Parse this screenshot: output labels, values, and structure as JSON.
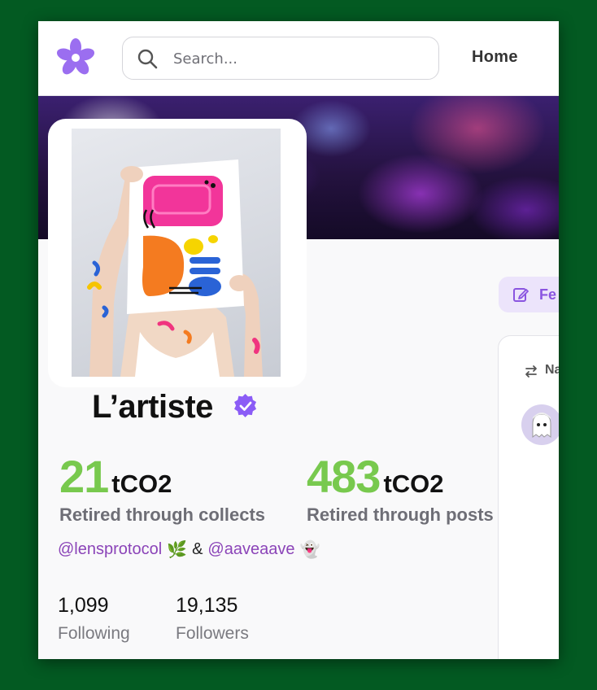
{
  "header": {
    "logo": "lens-flower-logo",
    "search": {
      "placeholder": "Search...",
      "value": ""
    },
    "nav": {
      "home_label": "Home"
    }
  },
  "profile": {
    "display_name": "L’artiste",
    "verified": true,
    "stats": [
      {
        "value": "21",
        "unit": "tCO2",
        "caption": "Retired through collects"
      },
      {
        "value": "483",
        "unit": "tCO2",
        "caption": "Retired through posts"
      }
    ],
    "bio": {
      "handle_1": "@lensprotocol",
      "handle_1_emoji": "🌿",
      "separator": "&",
      "handle_2": "@aaveaave",
      "handle_2_emoji": "👻"
    },
    "following": {
      "count": "1,099",
      "label": "Following"
    },
    "followers": {
      "count": "19,135",
      "label": "Followers"
    }
  },
  "sidebar": {
    "feed_button_label": "Fe",
    "card_label": "Na"
  },
  "colors": {
    "page_background": "#035a22",
    "accent_green": "#78c94e",
    "handle_purple": "#8b44b8",
    "brand_purple": "#8a55e0",
    "verified_badge": "#8b5cf6"
  }
}
